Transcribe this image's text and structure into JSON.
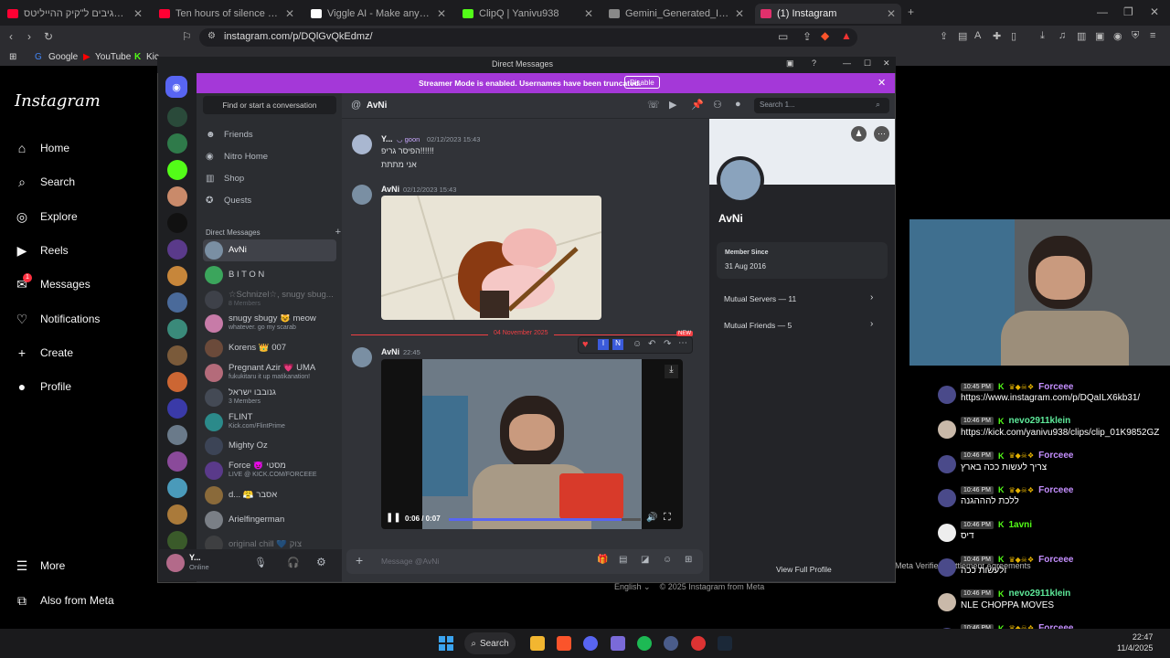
{
  "browser": {
    "tabs": [
      {
        "label": "סטרימרים מגיבים ל\"קיק ההייליטס | ...",
        "color": "#ff0033"
      },
      {
        "label": "Ten hours of silence occasionally bro...",
        "color": "#ff0033"
      },
      {
        "label": "Viggle AI - Make any character move",
        "color": "#ffffff"
      },
      {
        "label": "ClipQ | Yanivu938",
        "color": "#53fc18"
      },
      {
        "label": "Gemini_Generated_Image_csxvxcesx...",
        "color": "#888888"
      },
      {
        "label": "(1) Instagram",
        "color": "#e1306c"
      }
    ],
    "url": "instagram.com/p/DQlGvQkEdmz/",
    "bookmarks": [
      "Google",
      "YouTube",
      "Kic"
    ]
  },
  "instagram": {
    "logo": "Instagram",
    "nav": [
      {
        "label": "Home",
        "icon": "home-icon"
      },
      {
        "label": "Search",
        "icon": "search-icon"
      },
      {
        "label": "Explore",
        "icon": "compass-icon"
      },
      {
        "label": "Reels",
        "icon": "reels-icon"
      },
      {
        "label": "Messages",
        "icon": "messenger-icon",
        "badge": "1"
      },
      {
        "label": "Notifications",
        "icon": "heart-icon"
      },
      {
        "label": "Create",
        "icon": "plus-icon"
      },
      {
        "label": "Profile",
        "icon": "avatar-icon"
      }
    ],
    "more": "More",
    "also_from_meta": "Also from Meta",
    "footer_lang": "English",
    "footer_copy": "© 2025 Instagram from Meta",
    "meta_links": "Meta Verified   Settlement Agreements"
  },
  "discord": {
    "window_title": "Direct Messages",
    "banner": {
      "text": "Streamer Mode is enabled. Usernames have been truncated.",
      "button": "Disable"
    },
    "find": "Find or start a conversation",
    "channels": [
      {
        "label": "Friends",
        "icon": "friends-icon"
      },
      {
        "label": "Nitro Home",
        "icon": "nitro-icon"
      },
      {
        "label": "Shop",
        "icon": "shop-icon"
      },
      {
        "label": "Quests",
        "icon": "quests-icon"
      }
    ],
    "dm_header": "Direct Messages",
    "dms": [
      {
        "name": "AvNi",
        "sub": "",
        "color": "#7a8fa3",
        "active": true
      },
      {
        "name": "B I T O N",
        "sub": "",
        "color": "#3ba55c"
      },
      {
        "name": "☆Schnizel☆, snugy sbug...",
        "sub": "8 Members",
        "color": "#555a66",
        "dim": true
      },
      {
        "name": "snugy sbugy 😺 meow",
        "sub": "whatever. go my scarab",
        "color": "#c77ba8"
      },
      {
        "name": "Korens 👑 007",
        "sub": "",
        "color": "#6b4a3a"
      },
      {
        "name": "Pregnant Azir 💗 UMA",
        "sub": "fukukitaru it up matikanation!",
        "color": "#b46b7a"
      },
      {
        "name": "גנובבו ישראל",
        "sub": "3 Members",
        "color": "#444a55"
      },
      {
        "name": "FLINT",
        "sub": "Kick.com/FlintPrime",
        "color": "#2b8a8a"
      },
      {
        "name": "Mighty Oz",
        "sub": "",
        "color": "#3c4456"
      },
      {
        "name": "Force 😈 מסטי",
        "sub": "LIVE @ KICK.COM/FORCEEE",
        "color": "#5a3a8a"
      },
      {
        "name": "d... 😤 אסבר",
        "sub": "",
        "color": "#8a6a3a"
      },
      {
        "name": "Arielfingerman",
        "sub": "",
        "color": "#7a7f86"
      },
      {
        "name": "original chill 💙 צוק",
        "sub": "",
        "color": "#555",
        "dim": true
      }
    ],
    "user": {
      "name": "Y...",
      "status": "Online"
    },
    "chat_header": {
      "name": "AvNi",
      "search_placeholder": "Search 1..."
    },
    "messages": [
      {
        "author": "Y...",
        "tag": "◡ goon",
        "time": "02/12/2023 15:43",
        "lines": [
          "הפיסר גריפ!!!!!!",
          "אני מתתת"
        ],
        "color": "#a9b7d0"
      },
      {
        "author": "AvNi",
        "tag": "",
        "time": "02/12/2023 15:43",
        "lines": [],
        "color": "#7a8fa3"
      },
      {
        "author": "AvNi",
        "tag": "",
        "time": "22:45",
        "lines": [],
        "color": "#7a8fa3"
      }
    ],
    "divider": "04 November 2025",
    "new_badge": "NEW",
    "video": {
      "time": "0:06 / 0:07",
      "progress": 0.9
    },
    "composer_placeholder": "Message @AvNi",
    "profile": {
      "name": "AvNi",
      "member_since_label": "Member Since",
      "member_since": "31 Aug 2016",
      "mutual_servers": "Mutual Servers — 11",
      "mutual_friends": "Mutual Friends — 5",
      "view_full": "View Full Profile"
    }
  },
  "stream_chat": [
    {
      "time": "10:45 PM",
      "user": "Forceee",
      "color": "#c58fff",
      "text": "https://www.instagram.com/p/DQaILX6kb31/",
      "badges": true
    },
    {
      "time": "10:46 PM",
      "user": "nevo2911klein",
      "color": "#5eea9a",
      "text": "https://kick.com/yanivu938/clips/clip_01K9852GZ",
      "badges": false
    },
    {
      "time": "10:46 PM",
      "user": "Forceee",
      "color": "#c58fff",
      "text": "צריך לעשות ככה בארץ",
      "badges": true
    },
    {
      "time": "10:46 PM",
      "user": "Forceee",
      "color": "#c58fff",
      "text": "ללכת להההגנה",
      "badges": true
    },
    {
      "time": "10:46 PM",
      "user": "1avni",
      "color": "#53fc18",
      "text": "דיס",
      "badges": false
    },
    {
      "time": "10:46 PM",
      "user": "Forceee",
      "color": "#c58fff",
      "text": "ולעשות ככה",
      "badges": true
    },
    {
      "time": "10:46 PM",
      "user": "nevo2911klein",
      "color": "#5eea9a",
      "text": "NLE CHOPPA MOVES",
      "badges": false
    },
    {
      "time": "10:46 PM",
      "user": "Forceee",
      "color": "#c58fff",
      "text": "https://www.instagram.com/p/DQaILX6kb31/",
      "badges": true
    }
  ],
  "taskbar": {
    "search": "Search",
    "time": "22:47",
    "date": "11/4/2025"
  },
  "colors": {
    "discord_blurple": "#5865f2",
    "kick_green": "#53fc18",
    "streamer_purple": "#a438d8"
  }
}
